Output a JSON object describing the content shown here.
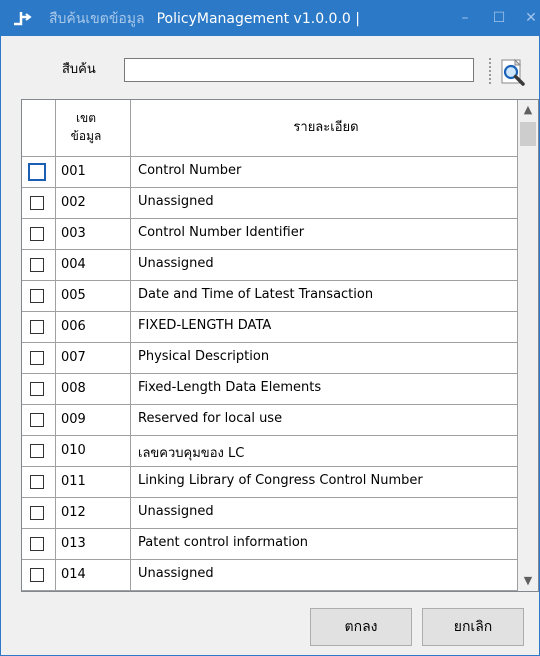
{
  "window": {
    "subtitle": "สืบค้นเขตข้อมูล",
    "title": "PolicyManagement v1.0.0.0 |",
    "min": "–",
    "max": "☐",
    "close": "✕"
  },
  "search": {
    "label": "สืบค้น",
    "value": "",
    "placeholder": ""
  },
  "table": {
    "columns": {
      "code": "เขต\nข้อมูล",
      "description": "รายละเอียด"
    },
    "rows": [
      {
        "code": "001",
        "description": "Control Number"
      },
      {
        "code": "002",
        "description": "Unassigned"
      },
      {
        "code": "003",
        "description": "Control Number Identifier"
      },
      {
        "code": "004",
        "description": "Unassigned"
      },
      {
        "code": "005",
        "description": "Date and Time of Latest Transaction"
      },
      {
        "code": "006",
        "description": "FIXED-LENGTH DATA"
      },
      {
        "code": "007",
        "description": "Physical Description"
      },
      {
        "code": "008",
        "description": "Fixed-Length Data Elements"
      },
      {
        "code": "009",
        "description": "Reserved for local use"
      },
      {
        "code": "010",
        "description": "เลขควบคุมของ LC"
      },
      {
        "code": "011",
        "description": "Linking Library of Congress Control Number"
      },
      {
        "code": "012",
        "description": "Unassigned"
      },
      {
        "code": "013",
        "description": "Patent control information"
      },
      {
        "code": "014",
        "description": "Unassigned"
      }
    ]
  },
  "buttons": {
    "ok": "ตกลง",
    "cancel": "ยกเลิก"
  },
  "icons": {
    "app": "app-logo-icon",
    "search": "magnifier-page-icon",
    "scroll_up": "▲",
    "scroll_down": "▼"
  },
  "colors": {
    "titlebar": "#2b79c7",
    "focus": "#1a5fb4"
  }
}
